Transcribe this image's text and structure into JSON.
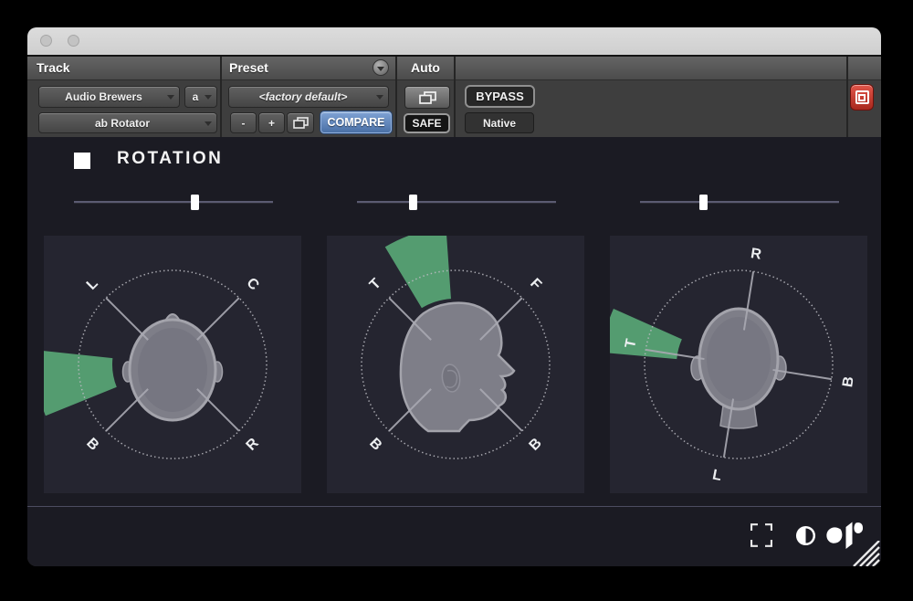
{
  "header": {
    "track": {
      "label": "Track",
      "track_name": "Audio Brewers",
      "automation_mode": "a",
      "plugin_name": "ab Rotator"
    },
    "preset": {
      "label": "Preset",
      "preset_name": "<factory default>",
      "minus": "-",
      "plus": "+",
      "compare": "COMPARE"
    },
    "auto": {
      "label": "Auto",
      "safe": "SAFE"
    },
    "bypass_label": "BYPASS",
    "native_label": "Native"
  },
  "main": {
    "section_title": "ROTATION"
  },
  "sliders": [
    {
      "name": "rotation-slider-1",
      "value": 0.61
    },
    {
      "name": "rotation-slider-2",
      "value": 0.28
    },
    {
      "name": "rotation-slider-3",
      "value": 0.32
    }
  ],
  "panels": [
    {
      "view": "top",
      "labels": [
        {
          "text": "L",
          "angle": 135,
          "r": 124,
          "rot": -45
        },
        {
          "text": "C",
          "angle": 45,
          "r": 124,
          "rot": 45
        },
        {
          "text": "B",
          "angle": 225,
          "r": 124,
          "rot": 45
        },
        {
          "text": "R",
          "angle": 315,
          "r": 124,
          "rot": -45
        }
      ],
      "cross": [
        45,
        135,
        225,
        315
      ],
      "wedge": {
        "start": 174,
        "end": 202,
        "inner": 66
      }
    },
    {
      "view": "side",
      "labels": [
        {
          "text": "T",
          "angle": 135,
          "r": 124,
          "rot": -45
        },
        {
          "text": "F",
          "angle": 45,
          "r": 124,
          "rot": 45
        },
        {
          "text": "B",
          "angle": 225,
          "r": 124,
          "rot": 45
        },
        {
          "text": "B",
          "angle": 315,
          "r": 124,
          "rot": -45
        }
      ],
      "cross": [
        45,
        135,
        225,
        315
      ],
      "wedge": {
        "start": 94,
        "end": 121,
        "inner": 72
      }
    },
    {
      "view": "back",
      "labels": [
        {
          "text": "R",
          "angle": 81,
          "r": 122,
          "rot": 9
        },
        {
          "text": "B",
          "angle": -9,
          "r": 122,
          "rot": -81
        },
        {
          "text": "L",
          "angle": 259,
          "r": 124,
          "rot": 11
        },
        {
          "text": "T",
          "angle": 169,
          "r": 120,
          "rot": -79
        }
      ],
      "cross": [
        81,
        171,
        261,
        351
      ],
      "wedge": {
        "start": 156,
        "end": 175,
        "inner": 68
      }
    }
  ],
  "icons": {
    "preset_menu": "chevron-down-circle",
    "duplicate": "overlapping-windows",
    "target": "target-square",
    "expand": "fullscreen-brackets",
    "contrast": "half-filled-circle",
    "logo": "audio-brewers-logo",
    "resize": "diagonal-stripes"
  },
  "colors": {
    "accent_green": "#56a274",
    "compare_blue": "#5c84c0",
    "target_red": "#c23b2e",
    "body_bg": "#1b1b23",
    "panel_bg": "#252530",
    "head_fill": "#7e7e88",
    "head_stroke": "#a3a3ab"
  }
}
